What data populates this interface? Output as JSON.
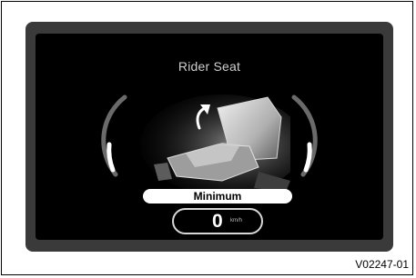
{
  "screen": {
    "title": "Rider Seat",
    "position_label": "Minimum",
    "speed": {
      "value": "0",
      "unit": "km/h"
    }
  },
  "icons": {
    "adjust_arrow": "up-arrow-icon",
    "seat": "seat-icon",
    "gauges": "seat-position-gauge"
  },
  "caption": "V02247-01",
  "colors": {
    "bezel": "#3a3a3a",
    "screen": "#000000",
    "text": "#cfcfcf"
  }
}
